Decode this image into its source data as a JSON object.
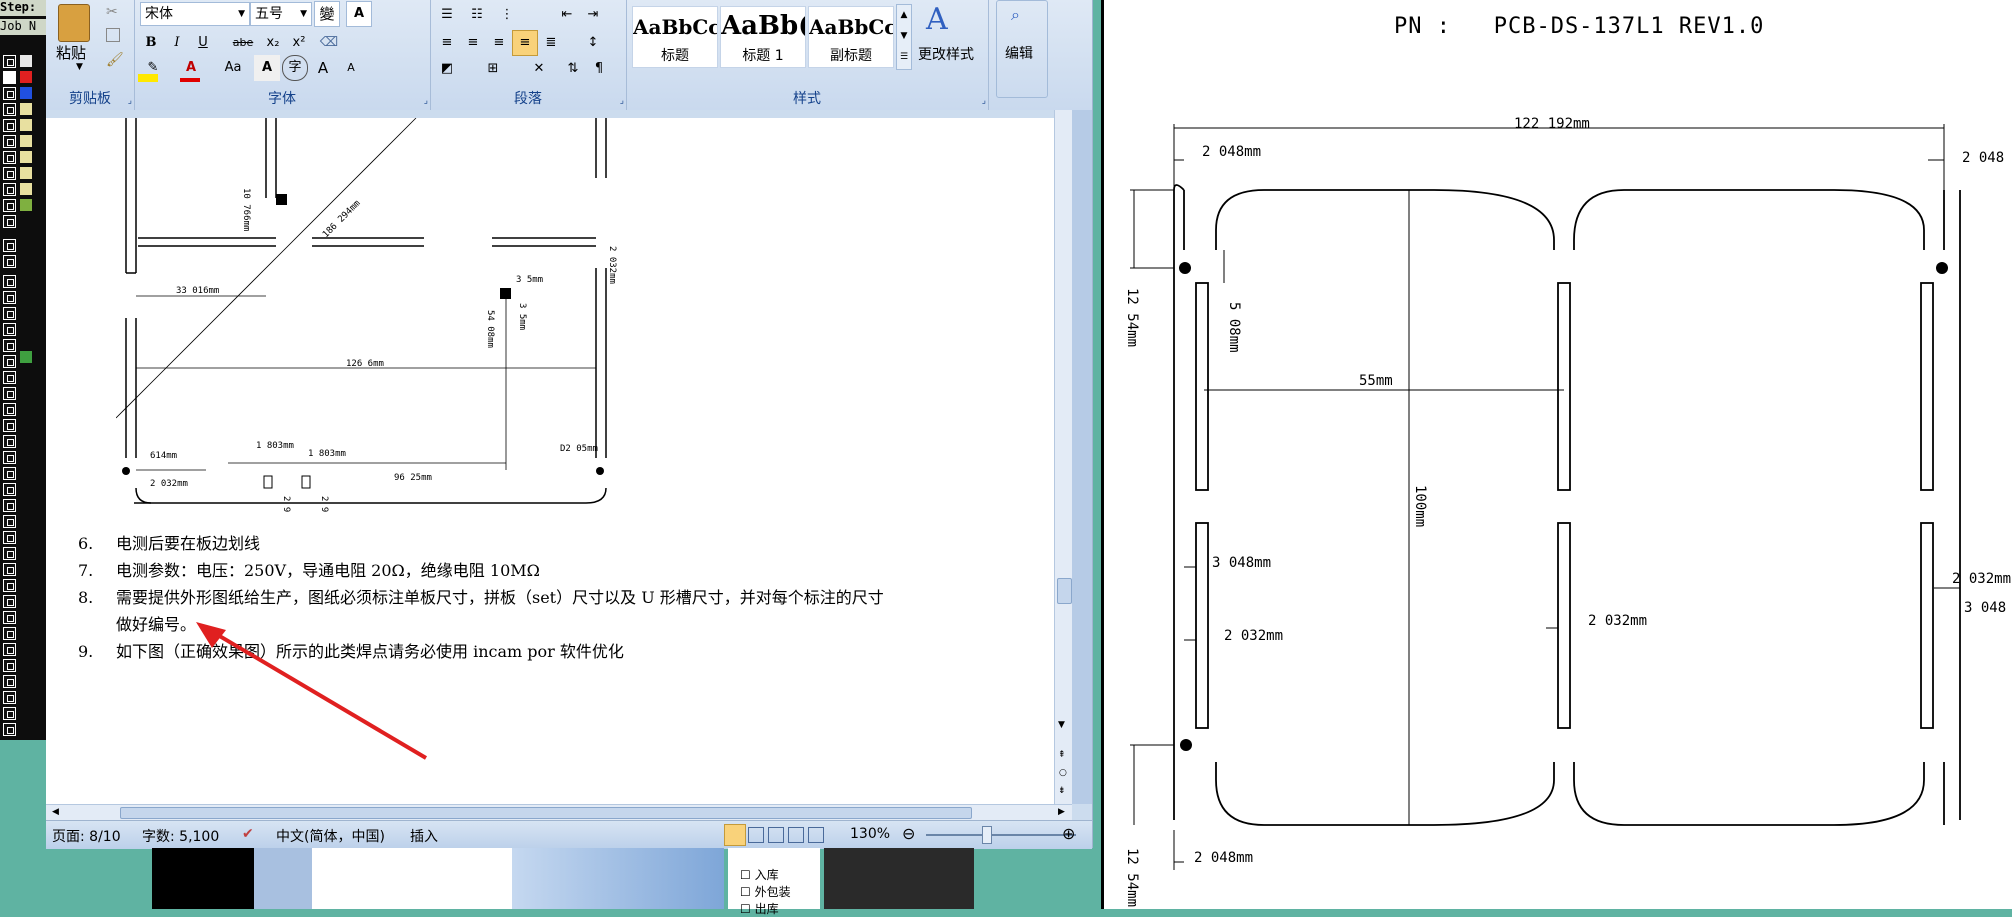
{
  "cam": {
    "step_label": "Step:",
    "job_label": "Job N"
  },
  "ribbon": {
    "paste_label": "粘贴",
    "font_name": "宋体",
    "font_size": "五号",
    "bold_label": "B",
    "italic_label": "I",
    "underline_label": "U",
    "strike_label": "abe",
    "sub_label": "x₂",
    "sup_label": "x²",
    "grow_label": "A",
    "shrink_label": "A",
    "case_label": "Aa",
    "styles": [
      {
        "preview": "AaBbCc",
        "name": "标题"
      },
      {
        "preview": "AaBb(",
        "name": "标题 1"
      },
      {
        "preview": "AaBbCc",
        "name": "副标题"
      }
    ],
    "change_styles_label": "更改样式",
    "edit_label": "编辑",
    "groups": {
      "clipboard": "剪贴板",
      "font": "字体",
      "paragraph": "段落",
      "styles": "样式"
    }
  },
  "doc": {
    "drawing_labels": {
      "d1": "33 016mm",
      "d2": "10 766mm",
      "d3": "186 294mm",
      "d4": "3 5mm",
      "d5": "2 032mm",
      "d6": "54 08mm",
      "d7": "3 5mm",
      "d8": "126 6mm",
      "d9": "1 803mm",
      "d10": "1 803mm",
      "d11": "D2 05mm",
      "d12": "614mm",
      "d13": "2 032mm",
      "d14": "96 25mm",
      "d15": "2 9",
      "d16": "2 9"
    },
    "items": [
      {
        "num": "6.",
        "text": "电测后要在板边划线"
      },
      {
        "num": "7.",
        "text": "电测参数：电压：250V，导通电阻 20Ω，绝缘电阻 10MΩ"
      },
      {
        "num": "8.",
        "text": "需要提供外形图纸给生产，图纸必须标注单板尺寸，拼板（set）尺寸以及 U 形槽尺寸，并对每个标注的尺寸",
        "text2": "做好编号。"
      },
      {
        "num": "9.",
        "text": "如下图（正确效果图）所示的此类焊点请务必使用 incam por 软件优化"
      }
    ],
    "arrow_color": "#e02020"
  },
  "status": {
    "page": "页面: 8/10",
    "words": "字数: 5,100",
    "language": "中文(简体，中国)",
    "mode": "插入",
    "zoom": "130%"
  },
  "explorer": {
    "items": [
      "入库",
      "外包装",
      "出库"
    ]
  },
  "pcb": {
    "title": "PN :   PCB-DS-137L1 REV1.0",
    "dims": {
      "width": "122 192mm",
      "left_top": "2 048mm",
      "right_top": "2 048",
      "height_left": "12 54mm",
      "slot_gap": "5 08mm",
      "mid": "55mm",
      "total_h": "100mm",
      "slot_w1": "3 048mm",
      "slot_w2": "2 032mm",
      "center_slot": "2 032mm",
      "right_slot1": "2 032mm",
      "right_slot2": "3 048",
      "bottom_left": "2 048mm",
      "bottom_height": "12 54mm"
    }
  }
}
